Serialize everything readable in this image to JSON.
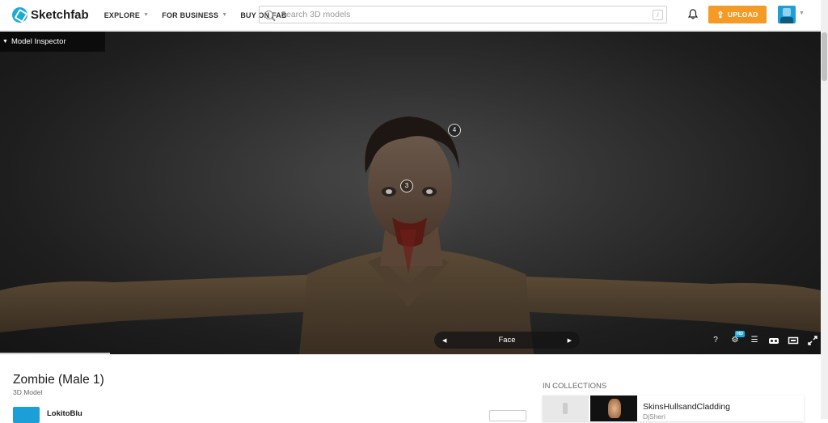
{
  "header": {
    "logo_text": "Sketchfab",
    "nav": [
      {
        "label": "EXPLORE",
        "has_dropdown": true
      },
      {
        "label": "FOR BUSINESS",
        "has_dropdown": true
      },
      {
        "label": "BUY ON FAB",
        "has_dropdown": false
      }
    ],
    "search_placeholder": "Search 3D models",
    "search_shortcut": "/",
    "upload_label": "UPLOAD",
    "accent_color": "#1caad9",
    "upload_color": "#f69a26"
  },
  "viewer": {
    "inspector_label": "Model Inspector",
    "hotspots": [
      "4",
      "3"
    ],
    "annotation_label": "Face",
    "hd_badge": "HD",
    "help_label": "?"
  },
  "model": {
    "title": "Zombie (Male 1)",
    "type": "3D Model",
    "author": "LokitoBlu"
  },
  "collections": {
    "label": "IN COLLECTIONS",
    "items": [
      {
        "name": "SkinsHullsandCladding",
        "author": "DjSheri"
      }
    ]
  }
}
